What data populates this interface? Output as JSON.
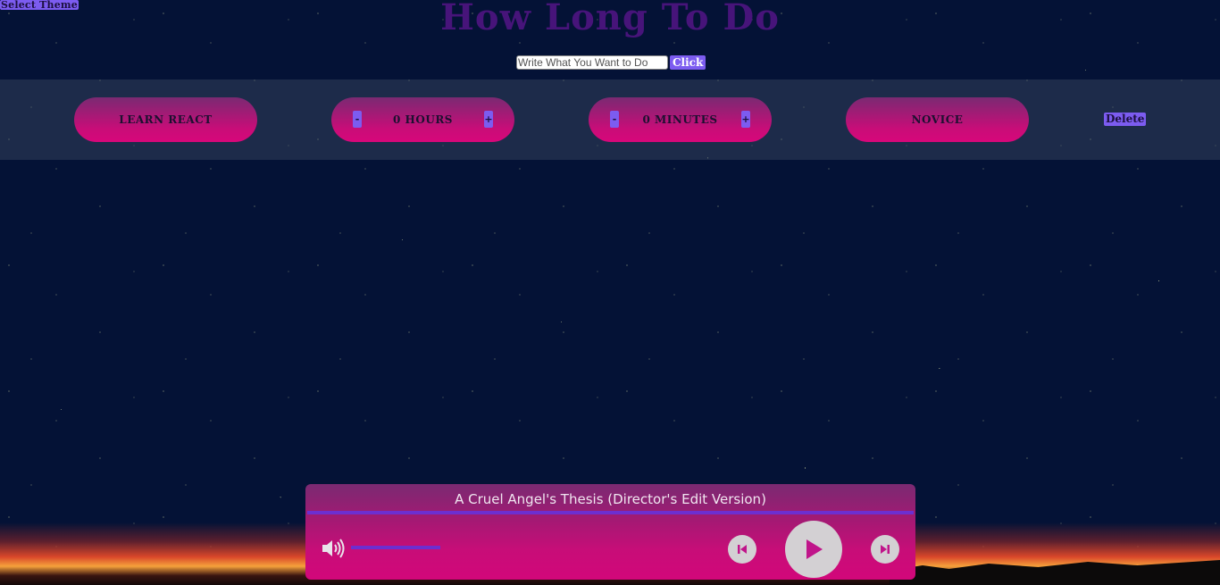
{
  "theme_button": {
    "label": "Select Theme"
  },
  "title": "How Long To Do",
  "add_task": {
    "placeholder": "Write What You Want to Do",
    "button_label": "Click"
  },
  "tasks": [
    {
      "name": "LEARN REACT",
      "hours_label": "0 HOURS",
      "minutes_label": "0 MINUTES",
      "level": "NOVICE",
      "minus": "-",
      "plus": "+",
      "delete_label": "Delete"
    }
  ],
  "player": {
    "track_title": "A Cruel Angel's Thesis (Director's Edit Version)",
    "progress_fraction": 1.0,
    "volume_fraction": 1.0,
    "icons": {
      "volume": "speaker-volume-icon",
      "prev": "skip-previous-icon",
      "play": "play-icon",
      "next": "skip-next-icon"
    }
  },
  "colors": {
    "background": "#041236",
    "title": "#47147a",
    "accent_button": "#7c5cf0",
    "pill_pink": "#c80d78",
    "player_progress": "#6c2fd0"
  }
}
